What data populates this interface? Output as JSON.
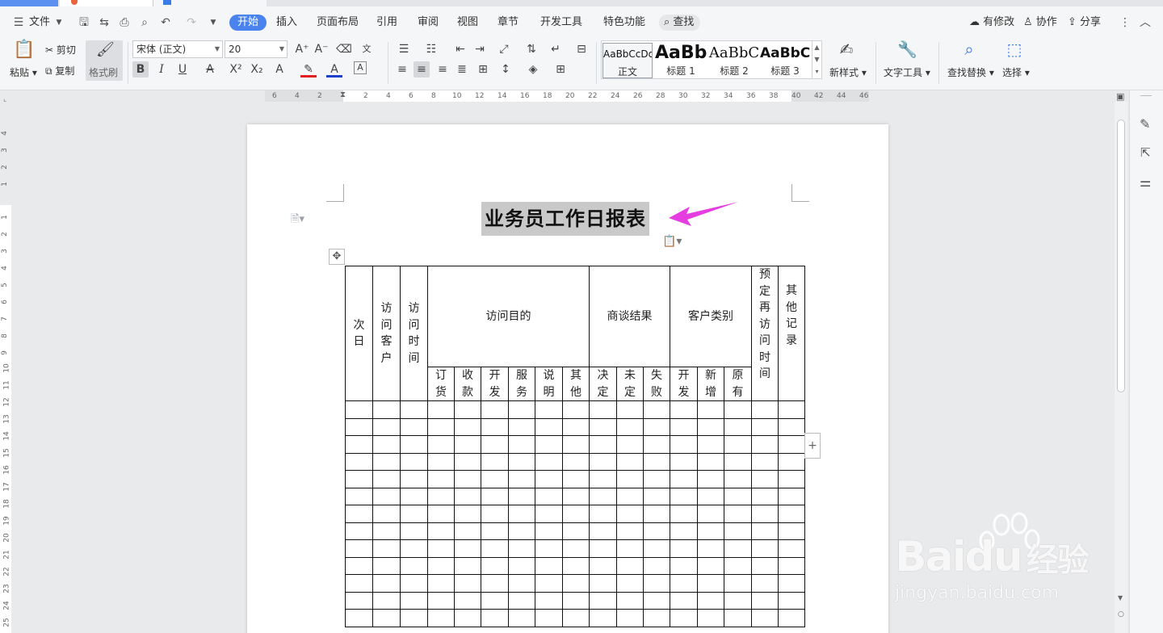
{
  "menu": {
    "file": "文件",
    "tabs": [
      {
        "label": "开始",
        "active": true
      },
      {
        "label": "插入"
      },
      {
        "label": "页面布局"
      },
      {
        "label": "引用"
      },
      {
        "label": "审阅"
      },
      {
        "label": "视图"
      },
      {
        "label": "章节"
      },
      {
        "label": "开发工具"
      },
      {
        "label": "特色功能"
      }
    ],
    "search": "查找",
    "right": {
      "modified": "有修改",
      "collab": "协作",
      "share": "分享"
    }
  },
  "ribbon": {
    "paste": "粘贴",
    "cut": "剪切",
    "copy": "复制",
    "format_painter": "格式刷",
    "font_name": "宋体 (正文)",
    "font_size": "20",
    "styles": [
      {
        "preview": "AaBbCcDd",
        "name": "正文",
        "selected": true
      },
      {
        "preview": "AaBb",
        "name": "标题 1"
      },
      {
        "preview": "AaBbC",
        "name": "标题 2"
      },
      {
        "preview": "AaBbC",
        "name": "标题 3"
      }
    ],
    "new_style": "新样式",
    "text_tools": "文字工具",
    "find_replace": "查找替换",
    "select": "选择"
  },
  "ruler": {
    "h_left": [
      "6",
      "4",
      "2"
    ],
    "h_right": [
      "2",
      "4",
      "6",
      "8",
      "10",
      "12",
      "14",
      "16",
      "18",
      "20",
      "22",
      "24",
      "26",
      "28",
      "30",
      "32",
      "34",
      "36",
      "38",
      "40",
      "42",
      "44",
      "46"
    ],
    "v_top": [
      "4",
      "3",
      "2",
      "1"
    ],
    "v_body": [
      "1",
      "2",
      "3",
      "4",
      "5",
      "6",
      "7",
      "8",
      "9",
      "10",
      "11",
      "12",
      "13",
      "14",
      "15",
      "16",
      "17",
      "18",
      "19",
      "20",
      "21",
      "22",
      "23",
      "24",
      "25"
    ]
  },
  "document": {
    "title": "业务员工作日报表",
    "table": {
      "header": {
        "day": "次日",
        "client": "访问客户",
        "time": "访问时间",
        "purpose": "访问目的",
        "result": "商谈结果",
        "category": "客户类别",
        "revisit": "预定再访问时间",
        "other": "其他记录"
      },
      "purpose_sub": [
        "订货",
        "收款",
        "开发",
        "服务",
        "说明",
        "其他"
      ],
      "result_sub": [
        "决定",
        "未定",
        "失败"
      ],
      "category_sub": [
        "开发",
        "新增",
        "原有"
      ]
    }
  },
  "watermark": {
    "brand": "Baidu",
    "cn": "经验",
    "url": "jingyan.baidu.com"
  },
  "colors": {
    "accent": "#4a83ee",
    "arrow": "#e53de0",
    "selection": "#c9c9c9"
  }
}
